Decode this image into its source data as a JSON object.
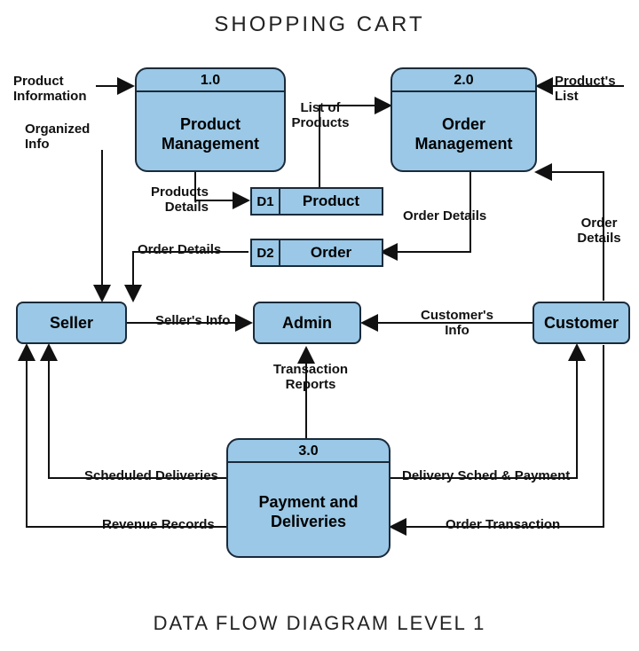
{
  "title": "SHOPPING CART",
  "footer": "DATA FLOW DIAGRAM LEVEL 1",
  "processes": {
    "p1": {
      "num": "1.0",
      "name": "Product Management"
    },
    "p2": {
      "num": "2.0",
      "name": "Order Management"
    },
    "p3": {
      "num": "3.0",
      "name": "Payment and Deliveries"
    }
  },
  "entities": {
    "seller": "Seller",
    "admin": "Admin",
    "customer": "Customer"
  },
  "datastores": {
    "d1": {
      "id": "D1",
      "name": "Product"
    },
    "d2": {
      "id": "D2",
      "name": "Order"
    }
  },
  "flows": {
    "product_info": "Product Information",
    "organized_info": "Organized Info",
    "products_details": "Products Details",
    "list_products": "List of Products",
    "products_list": "Product's List",
    "order_details_1": "Order Details",
    "order_details_2": "Order Details",
    "order_details_3": "Order Details",
    "sellers_info": "Seller's Info",
    "customers_info": "Customer's Info",
    "transaction_reports": "Transaction Reports",
    "scheduled_deliveries": "Scheduled Deliveries",
    "revenue_records": "Revenue Records",
    "delivery_sched": "Delivery Sched & Payment",
    "order_transaction": "Order Transaction"
  }
}
